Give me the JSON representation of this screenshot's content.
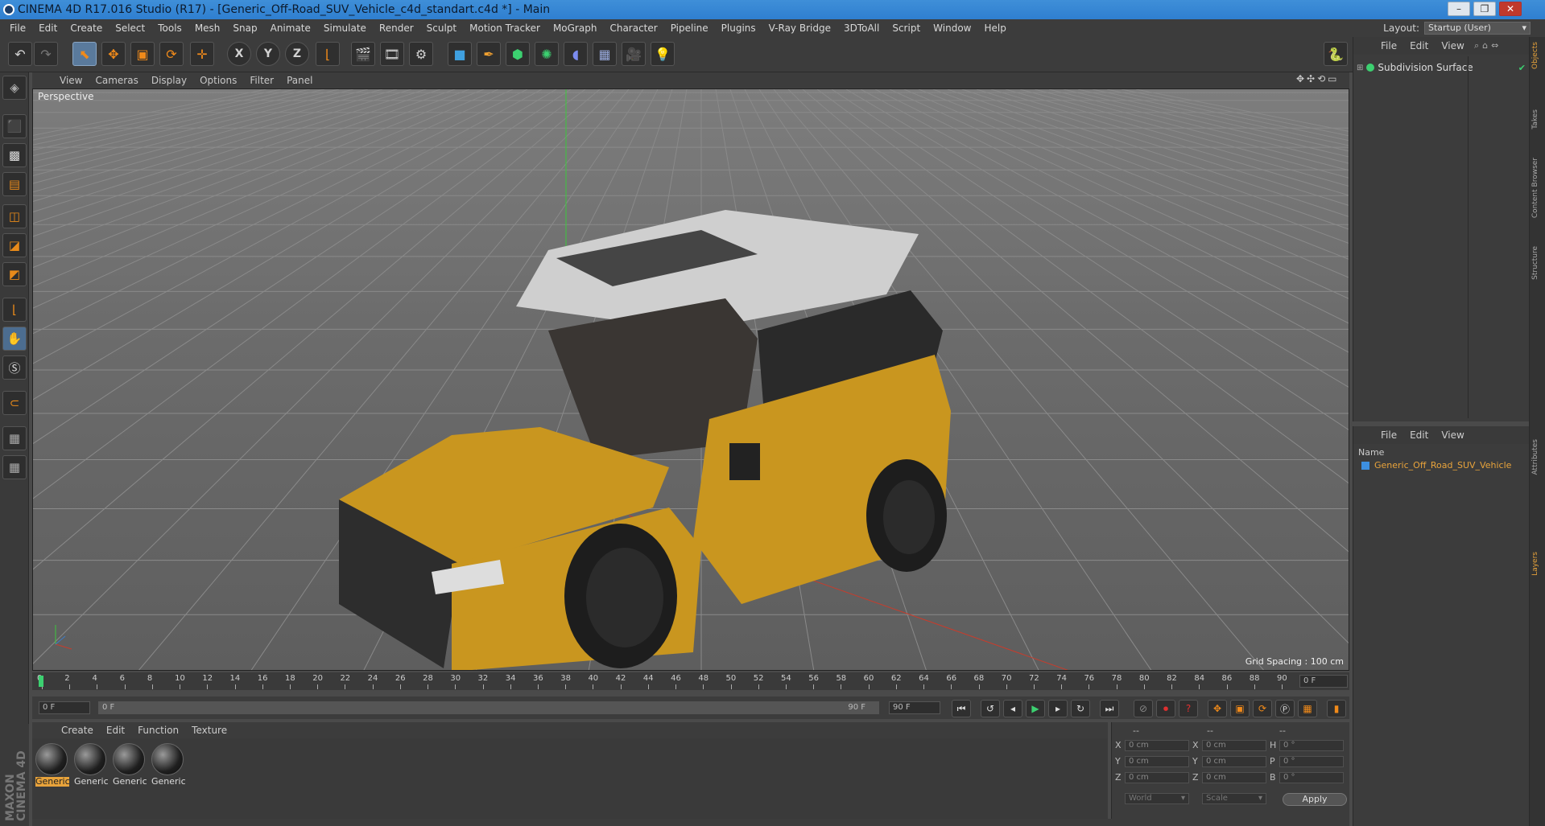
{
  "window": {
    "title": "CINEMA 4D R17.016 Studio (R17) - [Generic_Off-Road_SUV_Vehicle_c4d_standart.c4d *] - Main"
  },
  "menu": [
    "File",
    "Edit",
    "Create",
    "Select",
    "Tools",
    "Mesh",
    "Snap",
    "Animate",
    "Simulate",
    "Render",
    "Sculpt",
    "Motion Tracker",
    "MoGraph",
    "Character",
    "Pipeline",
    "Plugins",
    "V-Ray Bridge",
    "3DToAll",
    "Script",
    "Window",
    "Help"
  ],
  "layout": {
    "label": "Layout:",
    "value": "Startup (User)"
  },
  "toolbar": {
    "axis_x": "X",
    "axis_y": "Y",
    "axis_z": "Z"
  },
  "viewport": {
    "menu": [
      "View",
      "Cameras",
      "Display",
      "Options",
      "Filter",
      "Panel"
    ],
    "label": "Perspective",
    "grid_spacing": "Grid Spacing : 100 cm",
    "colors": {
      "body": "#c9961f",
      "axis_x": "#c83c2c",
      "axis_y": "#3cc83c"
    }
  },
  "timeline": {
    "ticks": [
      "0",
      "2",
      "4",
      "6",
      "8",
      "10",
      "12",
      "14",
      "16",
      "18",
      "20",
      "22",
      "24",
      "26",
      "28",
      "30",
      "32",
      "34",
      "36",
      "38",
      "40",
      "42",
      "44",
      "46",
      "48",
      "50",
      "52",
      "54",
      "56",
      "58",
      "60",
      "62",
      "64",
      "66",
      "68",
      "70",
      "72",
      "74",
      "76",
      "78",
      "80",
      "82",
      "84",
      "86",
      "88",
      "90"
    ],
    "current_frame": "0 F",
    "start_field": "0 F",
    "range_start": "0 F",
    "range_end": "90 F",
    "end_field": "90 F"
  },
  "materials": {
    "menu": [
      "Create",
      "Edit",
      "Function",
      "Texture"
    ],
    "items": [
      {
        "label": "Generic",
        "selected": true
      },
      {
        "label": "Generic",
        "selected": false
      },
      {
        "label": "Generic",
        "selected": false
      },
      {
        "label": "Generic",
        "selected": false
      }
    ]
  },
  "coordinates": {
    "headers": [
      "--",
      "--",
      "--"
    ],
    "pos": [
      {
        "axis": "X",
        "value": "0 cm"
      },
      {
        "axis": "Y",
        "value": "0 cm"
      },
      {
        "axis": "Z",
        "value": "0 cm"
      }
    ],
    "size": [
      {
        "axis": "X",
        "value": "0 cm"
      },
      {
        "axis": "Y",
        "value": "0 cm"
      },
      {
        "axis": "Z",
        "value": "0 cm"
      }
    ],
    "rot": [
      {
        "axis": "H",
        "value": "0 °"
      },
      {
        "axis": "P",
        "value": "0 °"
      },
      {
        "axis": "B",
        "value": "0 °"
      }
    ],
    "mode": "World",
    "scale": "Scale",
    "apply": "Apply"
  },
  "objects": {
    "menu": [
      "File",
      "Edit",
      "View"
    ],
    "items": [
      {
        "label": "Subdivision Surface"
      }
    ]
  },
  "layers": {
    "menu": [
      "File",
      "Edit",
      "View"
    ],
    "name_header": "Name",
    "items": [
      {
        "label": "Generic_Off_Road_SUV_Vehicle",
        "color": "#3d8fe0"
      }
    ]
  },
  "side_tabs": [
    "Objects",
    "Takes",
    "Content Browser",
    "Structure",
    "Attributes",
    "Layers"
  ],
  "brand": "MAXON CINEMA 4D"
}
